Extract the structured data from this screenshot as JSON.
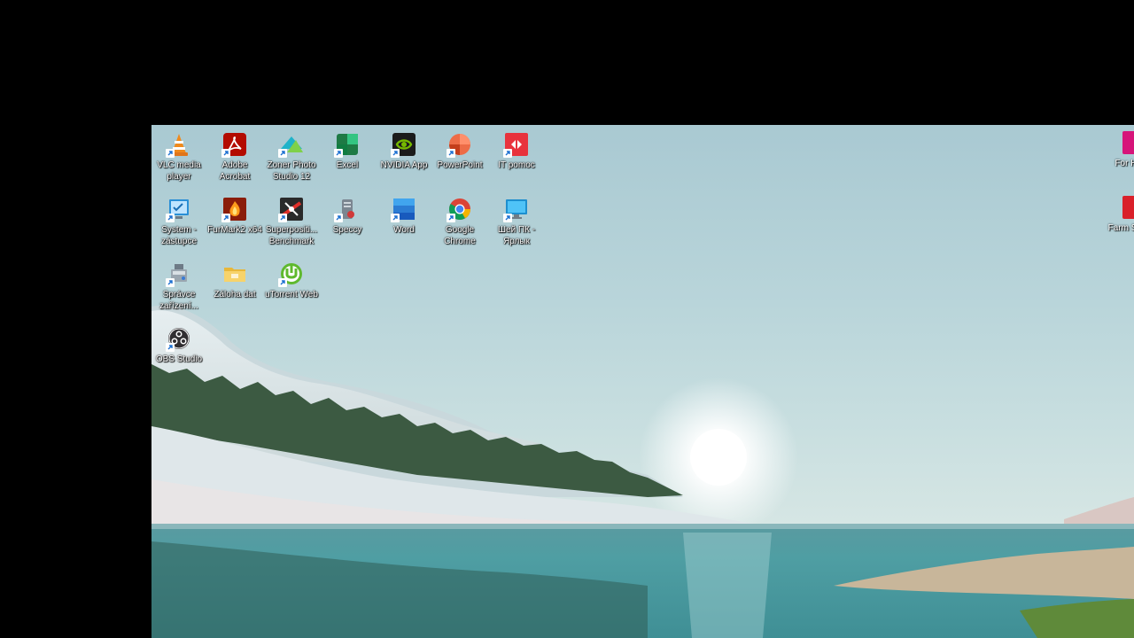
{
  "desktop": {
    "icons": [
      {
        "label": "VLC media player",
        "icon": "vlc-cone-icon"
      },
      {
        "label": "Adobe Acrobat",
        "icon": "acrobat-icon"
      },
      {
        "label": "Zoner Photo Studio 12",
        "icon": "zoner-photo-icon"
      },
      {
        "label": "Excel",
        "icon": "excel-icon"
      },
      {
        "label": "NVIDIA App",
        "icon": "nvidia-icon"
      },
      {
        "label": "PowerPoint",
        "icon": "powerpoint-icon"
      },
      {
        "label": "IT pomoc",
        "icon": "it-pomoc-icon"
      },
      {
        "label": "System - zástupce",
        "icon": "system-icon"
      },
      {
        "label": "FurMark2 x64",
        "icon": "furmark-icon"
      },
      {
        "label": "Superpositi... Benchmark",
        "icon": "superposition-icon"
      },
      {
        "label": "Speccy",
        "icon": "speccy-icon"
      },
      {
        "label": "Word",
        "icon": "word-icon"
      },
      {
        "label": "Google Chrome",
        "icon": "chrome-icon"
      },
      {
        "label": "Шей ПК - Ярлык",
        "icon": "monitor-icon"
      },
      {
        "label": "Správce zařízení...",
        "icon": "device-manager-icon"
      },
      {
        "label": "Záloha dat",
        "icon": "folder-icon"
      },
      {
        "label": "uTorrent Web",
        "icon": "utorrent-icon"
      },
      {
        "label": "OBS Studio",
        "icon": "obs-icon"
      }
    ],
    "edge_icons": [
      {
        "label": "For Horiz",
        "icon": "forza-horizon-icon"
      },
      {
        "label": "Farm Simula",
        "icon": "farming-simulator-icon"
      }
    ]
  },
  "colors": {
    "excel": "#1e7a45",
    "word": "#2b5cd1",
    "powerpoint": "#d24726",
    "acrobat": "#b30b00",
    "nvidia": "#76b900",
    "it_pomoc": "#e8323c"
  }
}
